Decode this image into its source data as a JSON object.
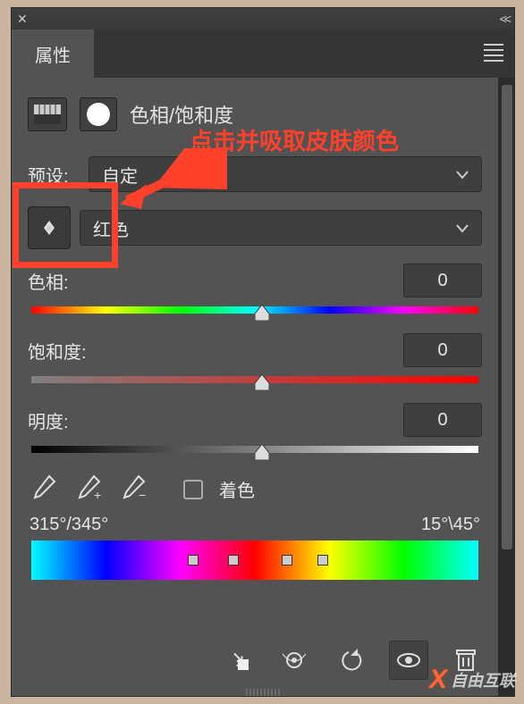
{
  "tab": {
    "label": "属性"
  },
  "panel": {
    "title": "色相/饱和度"
  },
  "preset": {
    "label": "预设:",
    "value": "自定"
  },
  "channel": {
    "value": "红色"
  },
  "hue": {
    "label": "色相:",
    "value": "0"
  },
  "saturation": {
    "label": "饱和度:",
    "value": "0"
  },
  "lightness": {
    "label": "明度:",
    "value": "0"
  },
  "colorize": {
    "label": "着色"
  },
  "range": {
    "left": "315°/345°",
    "right": "15°\\45°"
  },
  "annotation": {
    "text": "点击并吸取皮肤颜色"
  },
  "watermark": {
    "text": "自由互联"
  }
}
